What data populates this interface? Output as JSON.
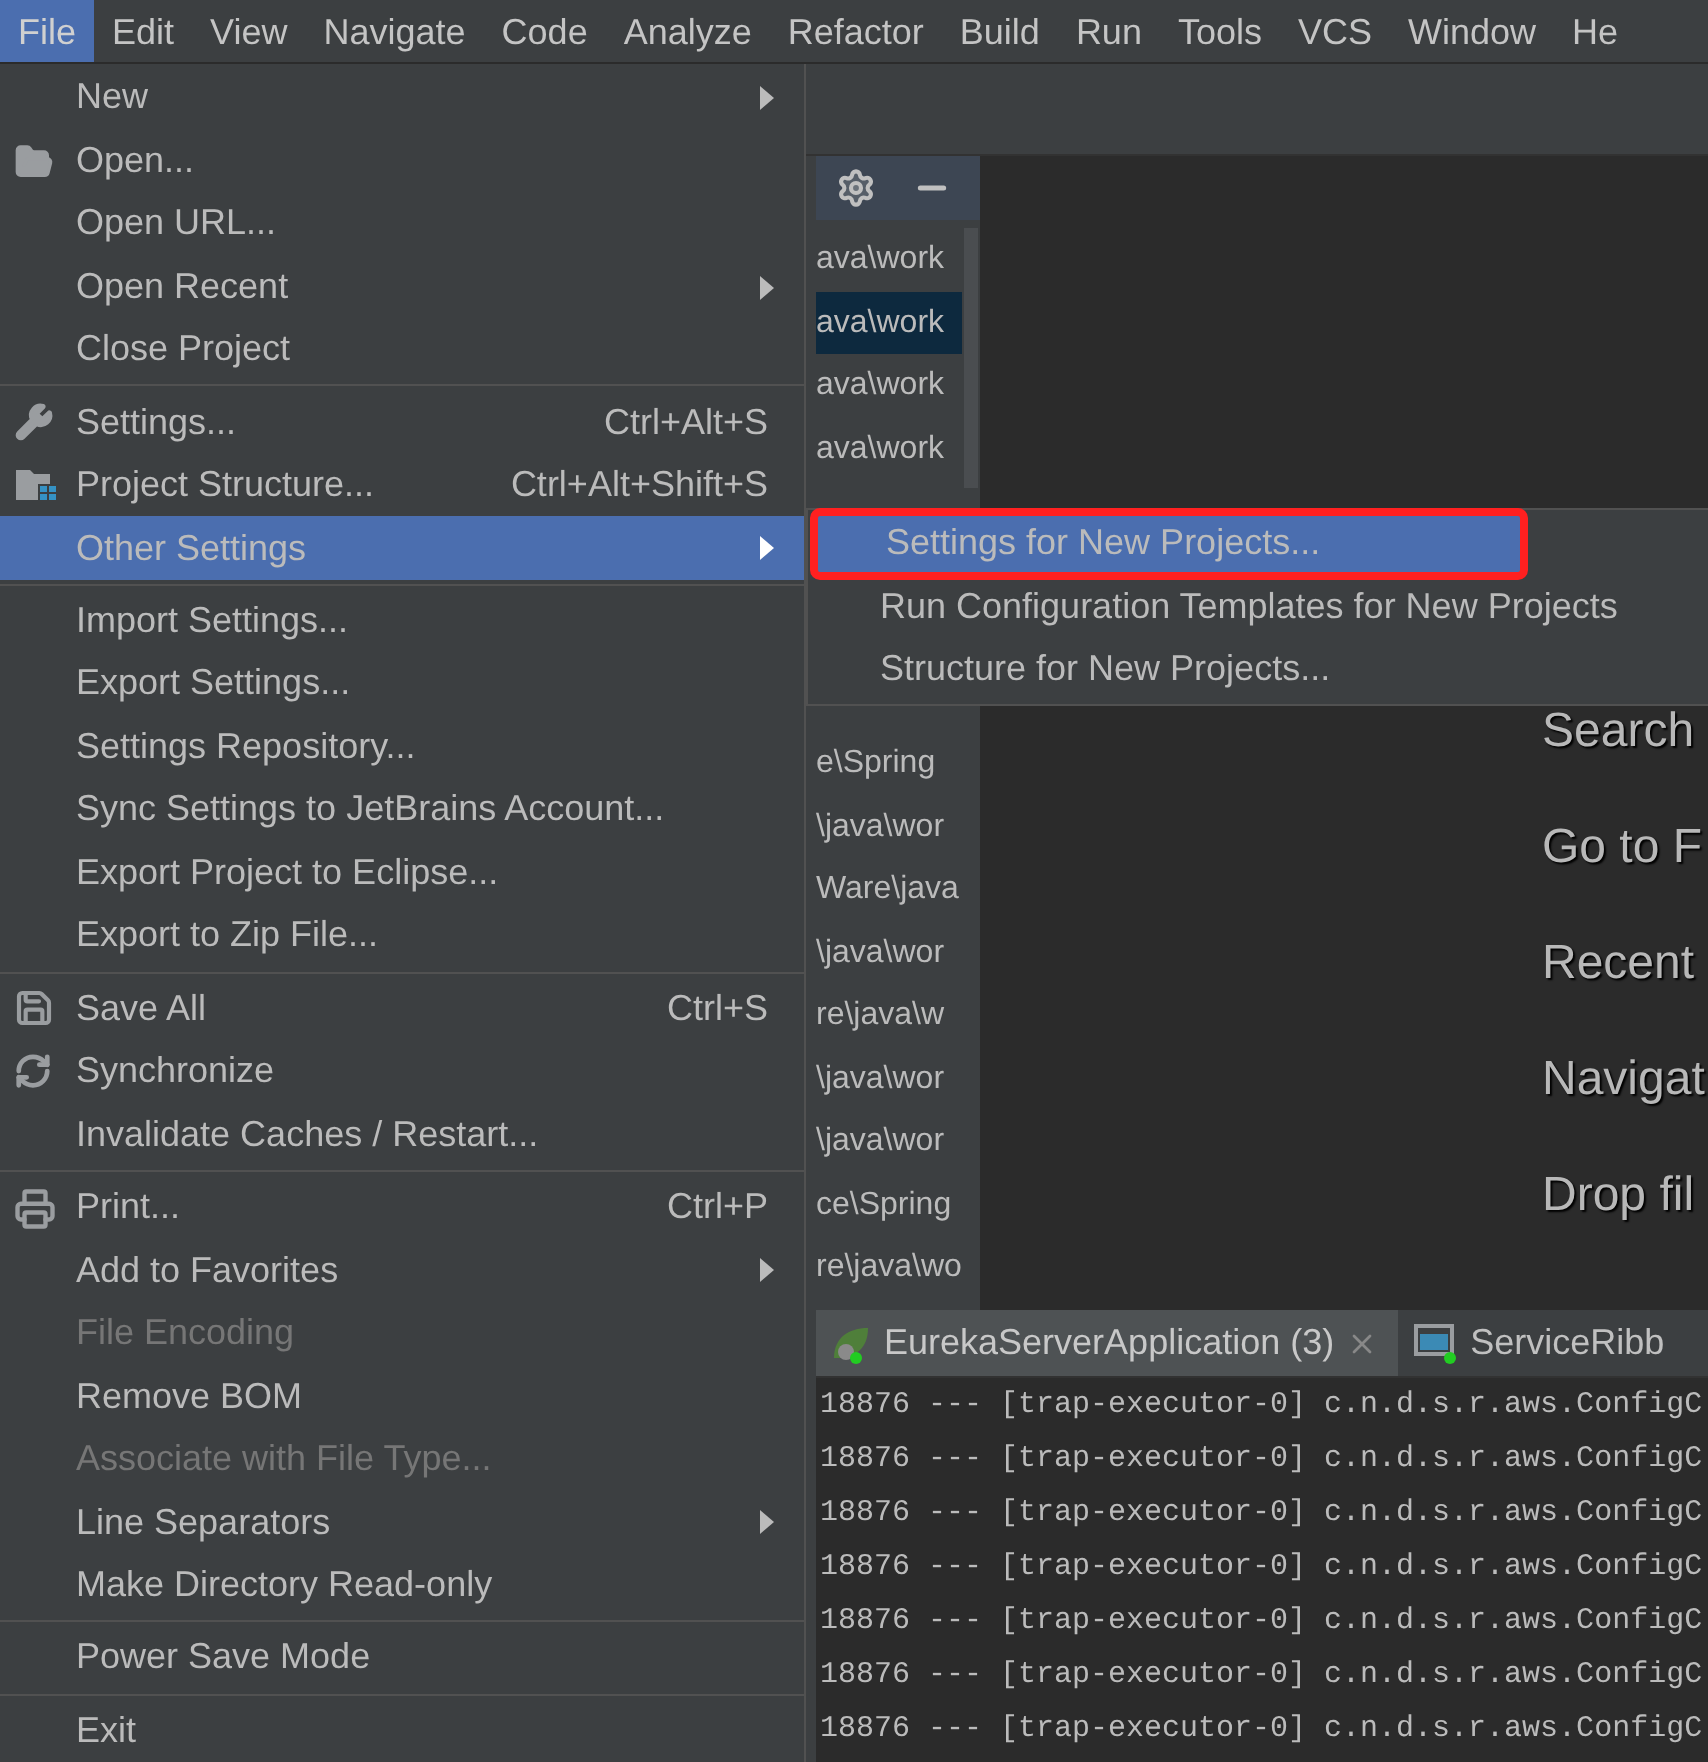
{
  "menu_bar": [
    {
      "label": "File",
      "selected": true
    },
    {
      "label": "Edit",
      "selected": false
    },
    {
      "label": "View",
      "selected": false
    },
    {
      "label": "Navigate",
      "selected": false
    },
    {
      "label": "Code",
      "selected": false
    },
    {
      "label": "Analyze",
      "selected": false
    },
    {
      "label": "Refactor",
      "selected": false
    },
    {
      "label": "Build",
      "selected": false
    },
    {
      "label": "Run",
      "selected": false
    },
    {
      "label": "Tools",
      "selected": false
    },
    {
      "label": "VCS",
      "selected": false
    },
    {
      "label": "Window",
      "selected": false
    },
    {
      "label": "He",
      "selected": false
    }
  ],
  "file_menu": {
    "items": [
      {
        "kind": "item",
        "label": "New",
        "submenu": true,
        "disabled": false,
        "selected": false
      },
      {
        "kind": "item",
        "label": "Open...",
        "submenu": false,
        "disabled": false,
        "selected": false
      },
      {
        "kind": "item",
        "label": "Open URL...",
        "submenu": false,
        "disabled": false,
        "selected": false
      },
      {
        "kind": "item",
        "label": "Open Recent",
        "submenu": true,
        "disabled": false,
        "selected": false
      },
      {
        "kind": "item",
        "label": "Close Project",
        "submenu": false,
        "disabled": false,
        "selected": false
      },
      {
        "kind": "separator"
      },
      {
        "kind": "item",
        "label": "Settings...",
        "shortcut": "Ctrl+Alt+S",
        "submenu": false,
        "disabled": false,
        "selected": false
      },
      {
        "kind": "item",
        "label": "Project Structure...",
        "shortcut": "Ctrl+Alt+Shift+S",
        "submenu": false,
        "disabled": false,
        "selected": false
      },
      {
        "kind": "item",
        "label": "Other Settings",
        "submenu": true,
        "disabled": false,
        "selected": true
      },
      {
        "kind": "separator"
      },
      {
        "kind": "item",
        "label": "Import Settings...",
        "submenu": false,
        "disabled": false,
        "selected": false
      },
      {
        "kind": "item",
        "label": "Export Settings...",
        "submenu": false,
        "disabled": false,
        "selected": false
      },
      {
        "kind": "item",
        "label": "Settings Repository...",
        "submenu": false,
        "disabled": false,
        "selected": false
      },
      {
        "kind": "item",
        "label": "Sync Settings to JetBrains Account...",
        "submenu": false,
        "disabled": false,
        "selected": false
      },
      {
        "kind": "item",
        "label": "Export Project to Eclipse...",
        "submenu": false,
        "disabled": false,
        "selected": false
      },
      {
        "kind": "item",
        "label": "Export to Zip File...",
        "submenu": false,
        "disabled": false,
        "selected": false
      },
      {
        "kind": "separator"
      },
      {
        "kind": "item",
        "label": "Save All",
        "shortcut": "Ctrl+S",
        "submenu": false,
        "disabled": false,
        "selected": false
      },
      {
        "kind": "item",
        "label": "Synchronize",
        "submenu": false,
        "disabled": false,
        "selected": false
      },
      {
        "kind": "item",
        "label": "Invalidate Caches / Restart...",
        "submenu": false,
        "disabled": false,
        "selected": false
      },
      {
        "kind": "separator"
      },
      {
        "kind": "item",
        "label": "Print...",
        "shortcut": "Ctrl+P",
        "submenu": false,
        "disabled": false,
        "selected": false
      },
      {
        "kind": "item",
        "label": "Add to Favorites",
        "submenu": true,
        "disabled": false,
        "selected": false
      },
      {
        "kind": "item",
        "label": "File Encoding",
        "submenu": false,
        "disabled": true,
        "selected": false
      },
      {
        "kind": "item",
        "label": "Remove BOM",
        "submenu": false,
        "disabled": false,
        "selected": false
      },
      {
        "kind": "item",
        "label": "Associate with File Type...",
        "submenu": false,
        "disabled": true,
        "selected": false
      },
      {
        "kind": "item",
        "label": "Line Separators",
        "submenu": true,
        "disabled": false,
        "selected": false
      },
      {
        "kind": "item",
        "label": "Make Directory Read-only",
        "submenu": false,
        "disabled": false,
        "selected": false
      },
      {
        "kind": "separator"
      },
      {
        "kind": "item",
        "label": "Power Save Mode",
        "submenu": false,
        "disabled": false,
        "selected": false
      },
      {
        "kind": "separator"
      },
      {
        "kind": "item",
        "label": "Exit",
        "submenu": false,
        "disabled": false,
        "selected": false
      }
    ]
  },
  "other_settings_submenu": {
    "items": [
      {
        "label": "Settings for New Projects...",
        "selected": true,
        "highlighted": true
      },
      {
        "label": "Run Configuration Templates for New Projects",
        "selected": false,
        "highlighted": false
      },
      {
        "label": "Structure for New Projects...",
        "selected": false,
        "highlighted": false
      }
    ]
  },
  "project_list": {
    "rows_top": [
      {
        "text": "ava\\work",
        "selected": false
      },
      {
        "text": "ava\\work",
        "selected": true
      },
      {
        "text": "ava\\work",
        "selected": false
      },
      {
        "text": "ava\\work",
        "selected": false
      }
    ],
    "rows_bottom": [
      {
        "text": "e\\Spring",
        "selected": false
      },
      {
        "text": "\\java\\wor",
        "selected": false
      },
      {
        "text": "Ware\\java",
        "selected": false
      },
      {
        "text": "\\java\\wor",
        "selected": false
      },
      {
        "text": "re\\java\\w",
        "selected": false
      },
      {
        "text": "\\java\\wor",
        "selected": false
      },
      {
        "text": "\\java\\wor",
        "selected": false
      },
      {
        "text": "ce\\Spring",
        "selected": false
      },
      {
        "text": "re\\java\\wo",
        "selected": false
      }
    ]
  },
  "welcome_hints": [
    "Search",
    "Go to F",
    "Recent",
    "Navigat",
    "Drop fil"
  ],
  "console": {
    "tabs": [
      {
        "label": "EurekaServerApplication (3)",
        "selected": true,
        "closable": true
      },
      {
        "label": "ServiceRibb",
        "selected": false,
        "closable": false
      }
    ],
    "lines": [
      "18876 --- [trap-executor-0] c.n.d.s.r.aws.ConfigC",
      "18876 --- [trap-executor-0] c.n.d.s.r.aws.ConfigC",
      "18876 --- [trap-executor-0] c.n.d.s.r.aws.ConfigC",
      "18876 --- [trap-executor-0] c.n.d.s.r.aws.ConfigC",
      "18876 --- [trap-executor-0] c.n.d.s.r.aws.ConfigC",
      "18876 --- [trap-executor-0] c.n.d.s.r.aws.ConfigC",
      "18876 --- [trap-executor-0] c.n.d.s.r.aws.ConfigC"
    ]
  }
}
